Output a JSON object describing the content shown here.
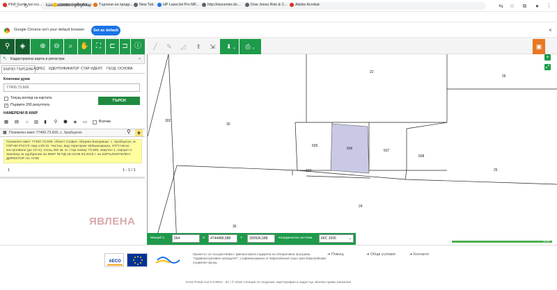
{
  "browser": {
    "url": "kais.cadastre.bg/bg/Map",
    "bookmarks": [
      {
        "label": "РКИ-Suche bei ins...",
        "color": "#d93025"
      },
      {
        "label": "купидон забежка...",
        "color": "#fbbc05"
      },
      {
        "label": "Търсене на продр...",
        "color": "#e8710a"
      },
      {
        "label": "New Tab",
        "color": "#5f6368"
      },
      {
        "label": "HP LaserJet Pro MF...",
        "color": "#1a73e8"
      },
      {
        "label": "http://isiscenter.do...",
        "color": "#5f6368"
      },
      {
        "label": "Dow Jones Risk & C...",
        "color": "#5f6368"
      },
      {
        "label": "Adobe Acrobat",
        "color": "#d93025"
      }
    ],
    "infobar_text": "Google Chrome isn't your default browser",
    "set_default": "Set as default"
  },
  "panel": {
    "layer_select": "Кадастрална карта и регистри",
    "tabs": [
      "БЪРЗО ТЪРСЕНЕ",
      "АДРЕС",
      "ИДЕНТИФИКАТОР",
      "СТАР ИДЕНТ.",
      "ГЕОД. ОСНОВА"
    ],
    "keywords_label": "Ключови думи",
    "keywords_value": "77400.73.606",
    "option1": "Текущ изглед на картата",
    "option2": "Първите 200 резултата",
    "search_button": "ТЪРСИ",
    "found_label": "НАМЕРЕНИ В КККР",
    "all_label": "Всички",
    "result_title": "Поземлен имот 77400.73.606, с. Храбърско",
    "result_text": "Поземлен имот 77400.73.606, област София, община Божурище, с. Храбърско, м. ГОРНИ РАСУЛ, вид собств. Частна, вид територия Урбанизирана, НТП Ниско застрояване (до 10 m), площ 482 кв. м, стар номер 73.606, квартал 1, парцел V. Заповед за одобрение на КККР № РД-18-31/28.03.2016 г. на ИЗПЪЛНИТЕЛЕН ДИРЕКТОР НА АГКК",
    "page_current": "1",
    "page_count": "1 - 1 / 1",
    "watermark": "ЯВЛЕНА"
  },
  "map": {
    "parcels": [
      "22",
      "26",
      "302",
      "30",
      "605",
      "606",
      "607",
      "608",
      "609",
      "25",
      "24",
      "36"
    ],
    "coords": {
      "scale_label": "Мащаб 1:",
      "scale_value": "564",
      "x_label": "X",
      "x_value": "4744489,588",
      "y_label": "Y",
      "y_value": "300506,588",
      "system_label": "Координатна система",
      "system_value": "ККС 2005"
    },
    "scalebar_label": "50 m"
  },
  "footer": {
    "project_text": "Проектът се осъществява с финансовата подкрепа на Оперативна програма \"Административен капацитет\", съфинансирана от Европейския съюз чрез Европейския социален фонд.",
    "links": [
      "Помощ",
      "Общи условия",
      "Контакти"
    ],
    "copyright": "KAIS Portal v12.2.0.9531 - 01 | © 2016 Агенция по геодезия, картография и кадастър. Всички права запазени!"
  },
  "colors": {
    "accent": "#1e9a4a",
    "selected_parcel": "#c9c9e6",
    "highlight": "#ffffa0"
  }
}
